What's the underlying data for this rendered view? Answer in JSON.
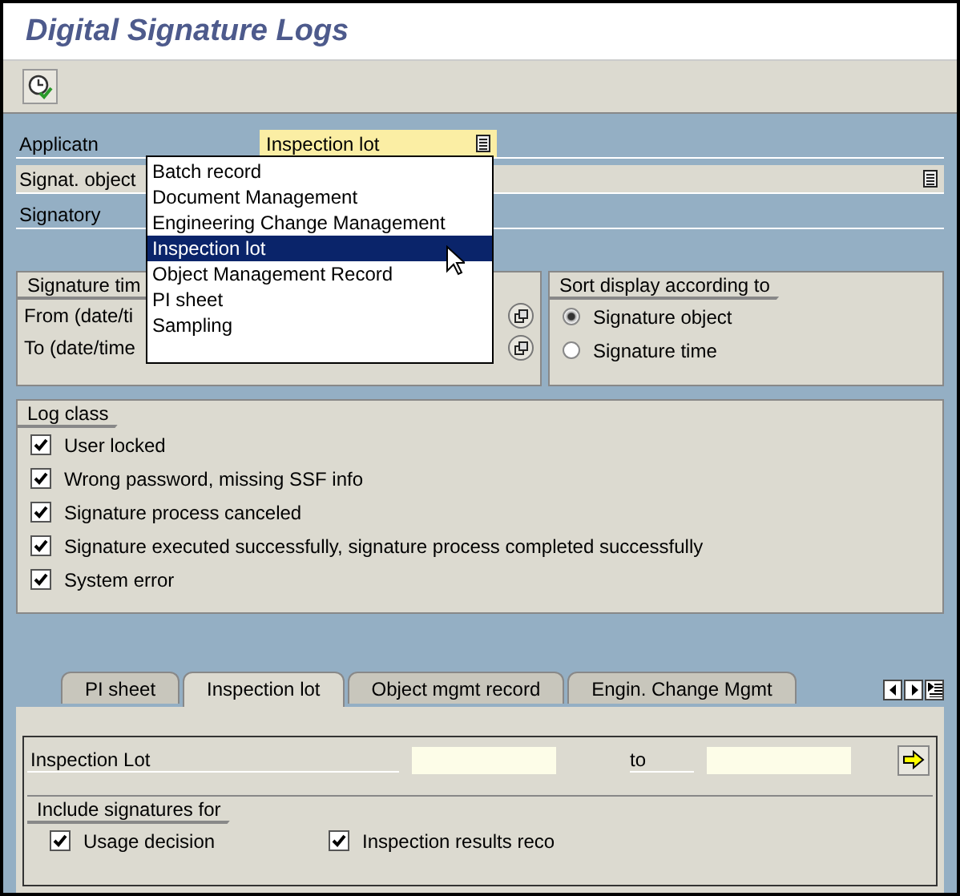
{
  "window": {
    "title": "Digital Signature Logs"
  },
  "toolbar": [
    {
      "kind": "execute"
    }
  ],
  "selection": {
    "fields": [
      {
        "label": "Applicatn",
        "value": "Inspection lot",
        "kind": "dropdown"
      },
      {
        "label": "Signat. object",
        "kind": "dropdown"
      },
      {
        "label": "Signatory",
        "kind": "text"
      }
    ]
  },
  "dropdown": {
    "options": [
      {
        "label": "Batch record",
        "selected": false
      },
      {
        "label": "Document Management",
        "selected": false
      },
      {
        "label": "Engineering Change Management",
        "selected": false
      },
      {
        "label": "Inspection lot",
        "selected": true
      },
      {
        "label": "Object Management Record",
        "selected": false
      },
      {
        "label": "PI sheet",
        "selected": false
      },
      {
        "label": "Sampling",
        "selected": false
      }
    ]
  },
  "signature_time": {
    "title": "Signature tim",
    "rows": [
      {
        "label": "From (date/ti"
      },
      {
        "label": "To (date/time"
      }
    ]
  },
  "sort_display": {
    "title": "Sort display according to",
    "options": [
      {
        "label": "Signature object",
        "selected": true
      },
      {
        "label": "Signature time",
        "selected": false
      }
    ]
  },
  "log_class": {
    "title": "Log class",
    "items": [
      {
        "label": "User locked",
        "checked": true
      },
      {
        "label": "Wrong password, missing SSF info",
        "checked": true
      },
      {
        "label": "Signature process canceled",
        "checked": true
      },
      {
        "label": "Signature executed successfully, signature process completed successfully",
        "checked": true
      },
      {
        "label": "System error",
        "checked": true
      }
    ]
  },
  "tabs": [
    {
      "label": "PI sheet",
      "selected": false
    },
    {
      "label": "Inspection lot",
      "selected": true
    },
    {
      "label": "Object mgmt record",
      "selected": false
    },
    {
      "label": "Engin. Change Mgmt",
      "selected": false
    }
  ],
  "tab_panel": {
    "range": {
      "label": "Inspection Lot",
      "to_label": "to"
    },
    "include": {
      "title": "Include signatures for",
      "items": [
        {
          "label": "Usage decision",
          "checked": true
        },
        {
          "label": "Inspection results reco",
          "checked": true
        }
      ]
    }
  }
}
